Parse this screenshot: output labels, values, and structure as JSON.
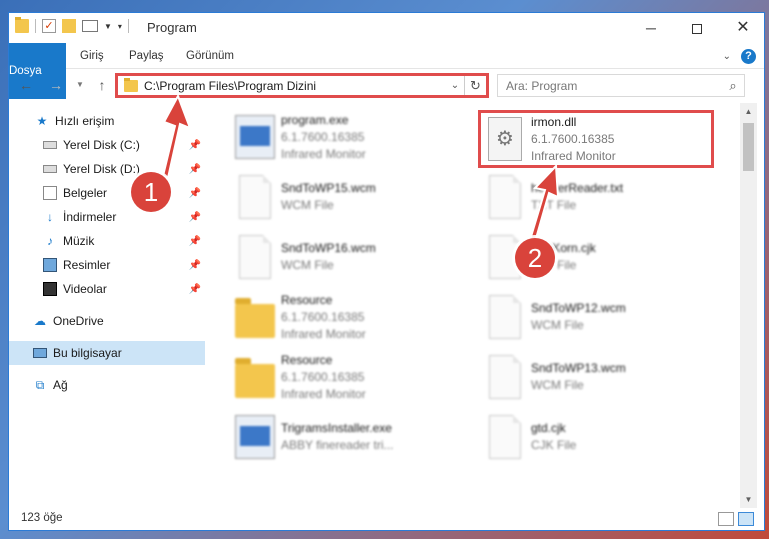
{
  "window": {
    "title": "Program",
    "minimize_label": "─",
    "close_label": "✕"
  },
  "ribbon": {
    "tabs": [
      "Dosya",
      "Giriş",
      "Paylaş",
      "Görünüm"
    ],
    "help_label": "?"
  },
  "navigation": {
    "address_path": "C:\\Program Files\\Program Dizini",
    "search_placeholder": "Ara: Program"
  },
  "sidebar": {
    "items": [
      {
        "label": "Hızlı erişim",
        "icon": "star-icon",
        "pinned": false
      },
      {
        "label": "Yerel Disk (C:)",
        "icon": "drive-icon",
        "pinned": true
      },
      {
        "label": "Yerel Disk (D:)",
        "icon": "drive-icon",
        "pinned": true
      },
      {
        "label": "Belgeler",
        "icon": "documents-icon",
        "pinned": true
      },
      {
        "label": "İndirmeler",
        "icon": "downloads-icon",
        "pinned": true
      },
      {
        "label": "Müzik",
        "icon": "music-icon",
        "pinned": true
      },
      {
        "label": "Resimler",
        "icon": "pictures-icon",
        "pinned": true
      },
      {
        "label": "Videolar",
        "icon": "videos-icon",
        "pinned": true
      },
      {
        "label": "OneDrive",
        "icon": "cloud-icon",
        "pinned": false
      },
      {
        "label": "Bu bilgisayar",
        "icon": "computer-icon",
        "pinned": false,
        "selected": true
      },
      {
        "label": "Ağ",
        "icon": "network-icon",
        "pinned": false
      }
    ]
  },
  "files": [
    {
      "name": "program.exe",
      "line2": "6.1.7600.16385",
      "line3": "Infrared Monitor",
      "icon": "exe-icon"
    },
    {
      "name": "irmon.dll",
      "line2": "6.1.7600.16385",
      "line3": "Infrared Monitor",
      "icon": "dll-icon",
      "highlighted": true
    },
    {
      "name": "SndToWP15.wcm",
      "line2": "WCM File",
      "line3": "",
      "icon": "document-icon"
    },
    {
      "name": "headerReader.txt",
      "line2": "TXT File",
      "line3": "",
      "icon": "document-icon"
    },
    {
      "name": "SndToWP16.wcm",
      "line2": "WCM File",
      "line3": "",
      "icon": "document-icon"
    },
    {
      "name": "SndKorn.cjk",
      "line2": "CJK File",
      "line3": "",
      "icon": "document-icon"
    },
    {
      "name": "Resource",
      "line2": "6.1.7600.16385",
      "line3": "Infrared Monitor",
      "icon": "folder-icon"
    },
    {
      "name": "SndToWP12.wcm",
      "line2": "WCM File",
      "line3": "",
      "icon": "document-icon"
    },
    {
      "name": "Resource",
      "line2": "6.1.7600.16385",
      "line3": "Infrared Monitor",
      "icon": "folder-icon"
    },
    {
      "name": "SndToWP13.wcm",
      "line2": "WCM File",
      "line3": "",
      "icon": "document-icon"
    },
    {
      "name": "TrigramsInstaller.exe",
      "line2": "ABBY finereader tri...",
      "line3": "",
      "icon": "installer-icon"
    },
    {
      "name": "gtd.cjk",
      "line2": "CJK File",
      "line3": "",
      "icon": "document-icon"
    }
  ],
  "status": {
    "item_count": "123 öğe"
  },
  "annotations": {
    "step1": "1",
    "step2": "2"
  },
  "colors": {
    "accent": "#1979ca",
    "highlight_border": "#e04c4c",
    "callout": "#d9433b",
    "selected_bg": "#cce4f7"
  }
}
